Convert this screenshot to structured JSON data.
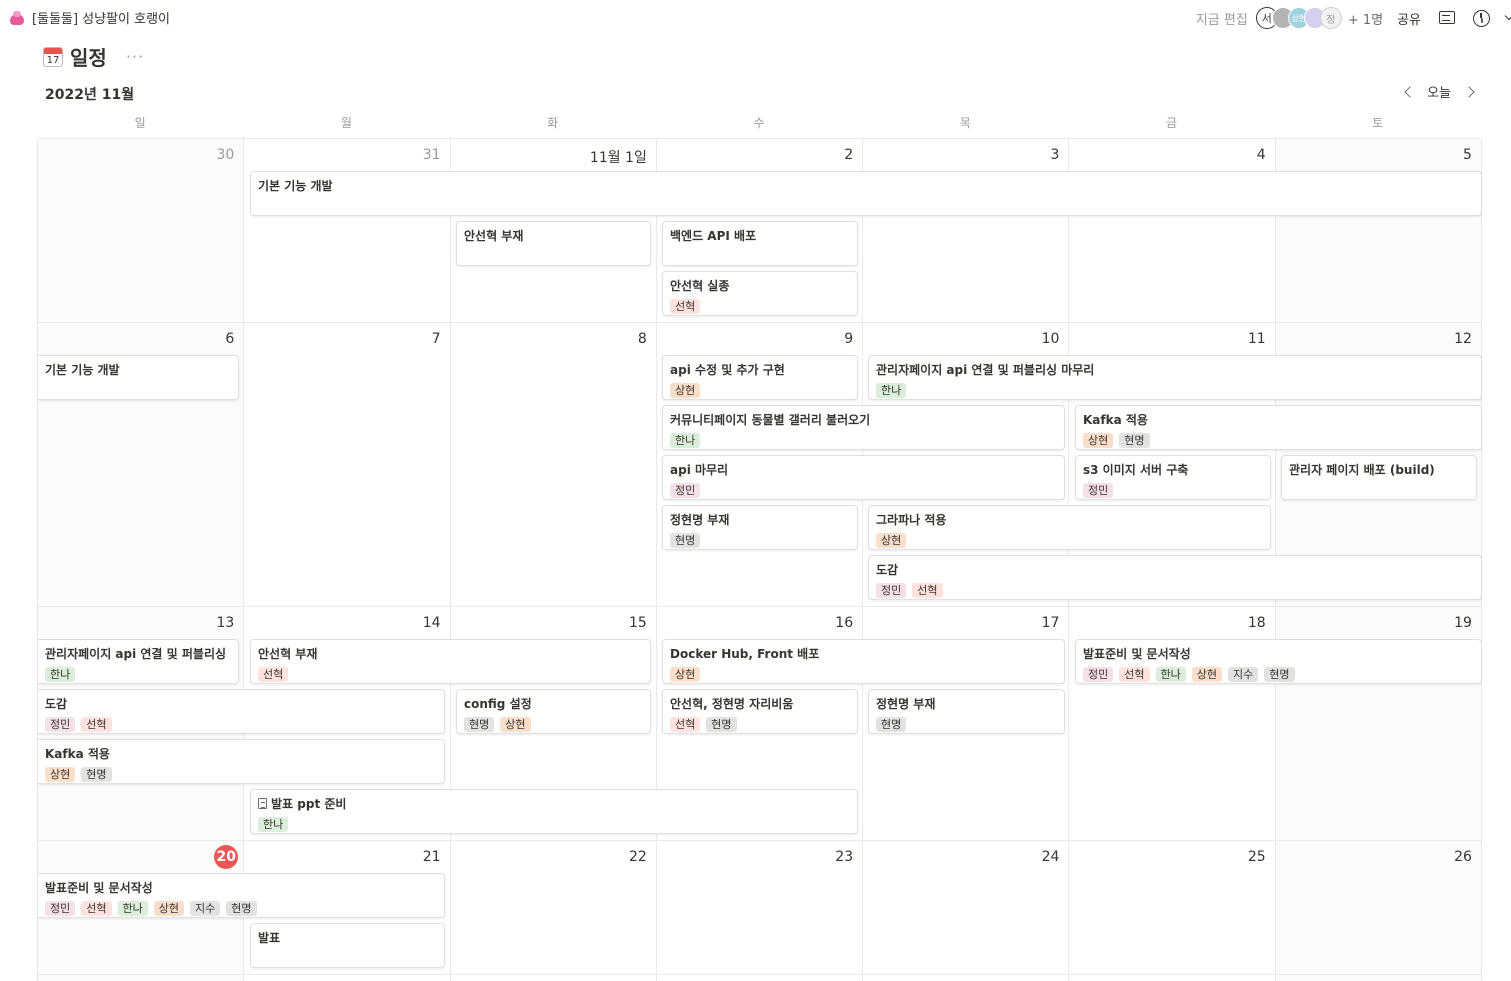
{
  "breadcrumb": {
    "title": "[둘둘둘] 성냥팔이 호랭이"
  },
  "topbar": {
    "editing_label": "지금 편집",
    "avatars": [
      "서",
      "",
      "상현",
      "",
      "정"
    ],
    "more_users": "+ 1명",
    "share_label": "공유"
  },
  "page": {
    "title": "일정",
    "icon_day": "17",
    "more": "···"
  },
  "calendar": {
    "month_label": "2022년 11월",
    "today_label": "오늘",
    "weekdays": [
      "일",
      "월",
      "화",
      "수",
      "목",
      "금",
      "토"
    ],
    "weeks": [
      {
        "days": [
          "30",
          "31",
          "11월 1일",
          "2",
          "3",
          "4",
          "5"
        ],
        "events": [
          {
            "title": "기본 기능 개발",
            "tags": []
          },
          {
            "title": "안선혁 부재",
            "tags": []
          },
          {
            "title": "백엔드 API 배포",
            "tags": []
          },
          {
            "title": "안선혁 실종",
            "tags": [
              "선혁"
            ]
          }
        ]
      },
      {
        "days": [
          "6",
          "7",
          "8",
          "9",
          "10",
          "11",
          "12"
        ],
        "events": [
          {
            "title": "기본 기능 개발",
            "tags": []
          },
          {
            "title": "api 수정 및 추가 구현",
            "tags": [
              "상현"
            ]
          },
          {
            "title": "관리자페이지 api 연결 및 퍼블리싱 마무리",
            "tags": [
              "한나"
            ]
          },
          {
            "title": "커뮤니티페이지 동물별 갤러리 불러오기",
            "tags": [
              "한나"
            ]
          },
          {
            "title": "Kafka 적용",
            "tags": [
              "상현",
              "현명"
            ]
          },
          {
            "title": "api 마무리",
            "tags": [
              "정민"
            ]
          },
          {
            "title": "s3 이미지 서버 구축",
            "tags": [
              "정민"
            ]
          },
          {
            "title": "관리자 페이지 배포 (build)",
            "tags": []
          },
          {
            "title": "정현명 부재",
            "tags": [
              "현명"
            ]
          },
          {
            "title": "그라파나 적용",
            "tags": [
              "상현"
            ]
          },
          {
            "title": "도감",
            "tags": [
              "정민",
              "선혁"
            ]
          }
        ]
      },
      {
        "days": [
          "13",
          "14",
          "15",
          "16",
          "17",
          "18",
          "19"
        ],
        "events": [
          {
            "title": "관리자페이지 api 연결 및 퍼블리싱 ...",
            "tags": [
              "한나"
            ]
          },
          {
            "title": "안선혁 부재",
            "tags": [
              "선혁"
            ]
          },
          {
            "title": "Docker Hub, Front 배포",
            "tags": [
              "상현"
            ]
          },
          {
            "title": "발표준비 및 문서작성",
            "tags": [
              "정민",
              "선혁",
              "한나",
              "상현",
              "지수",
              "현명"
            ]
          },
          {
            "title": "도감",
            "tags": [
              "정민",
              "선혁"
            ]
          },
          {
            "title": "config 설정",
            "tags": [
              "현명",
              "상현"
            ]
          },
          {
            "title": "안선혁, 정현명 자리비움",
            "tags": [
              "선혁",
              "현명"
            ]
          },
          {
            "title": "정현명 부재",
            "tags": [
              "현명"
            ]
          },
          {
            "title": "Kafka 적용",
            "tags": [
              "상현",
              "현명"
            ]
          },
          {
            "title": "발표 ppt 준비",
            "tags": [
              "한나"
            ]
          }
        ]
      },
      {
        "days": [
          "20",
          "21",
          "22",
          "23",
          "24",
          "25",
          "26"
        ],
        "events": [
          {
            "title": "발표준비 및 문서작성",
            "tags": [
              "정민",
              "선혁",
              "한나",
              "상현",
              "지수",
              "현명"
            ]
          },
          {
            "title": "발표",
            "tags": []
          }
        ]
      }
    ]
  },
  "tag_colors": {
    "정민": "#f5e0e9",
    "선혁": "#ffe2dd",
    "한나": "#dbeddb",
    "상현": "#fadec9",
    "지수": "#e3e2e0",
    "현명": "#e3e2e0"
  }
}
